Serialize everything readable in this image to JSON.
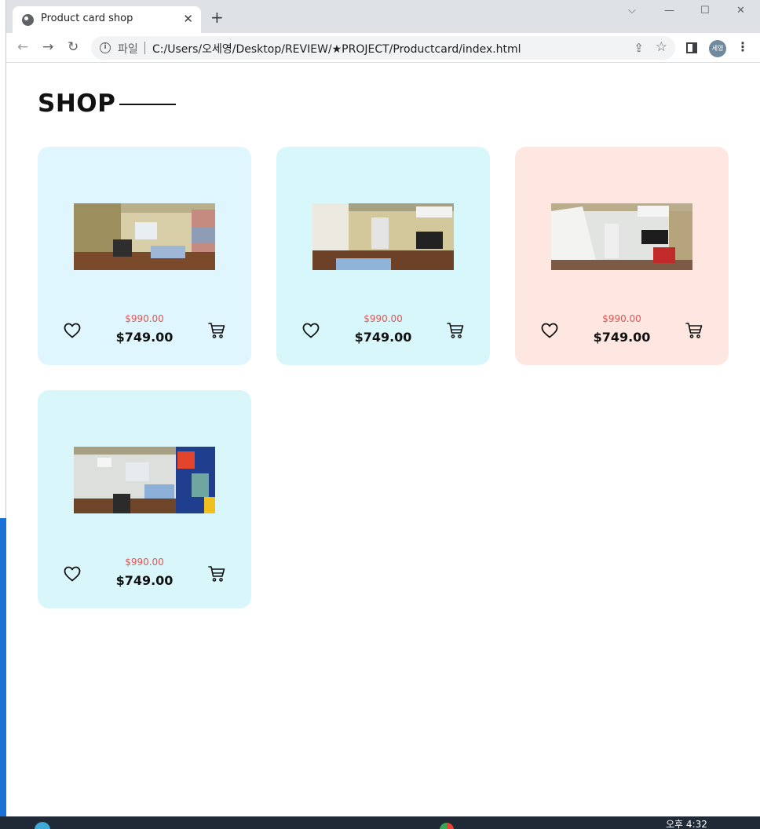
{
  "browser": {
    "tab_title": "Product card shop",
    "tab_close": "✕",
    "new_tab": "+",
    "window": {
      "dropdown": "⌵",
      "minimize": "—",
      "maximize": "☐",
      "close": "✕"
    },
    "nav": {
      "back": "←",
      "forward": "→",
      "reload": "↻"
    },
    "omnibox": {
      "info_glyph": "i",
      "scheme_label": "파일",
      "url": "C:/Users/오세영/Desktop/REVIEW/★PROJECT/Productcard/index.html"
    },
    "avatar_label": "세영",
    "menu": "⋮"
  },
  "page": {
    "title": "SHOP"
  },
  "products": [
    {
      "old_price": "$990.00",
      "price": "$749.00",
      "bg": "#e0f6fe",
      "photo": "room-a"
    },
    {
      "old_price": "$990.00",
      "price": "$749.00",
      "bg": "#d8f7fa",
      "photo": "room-b"
    },
    {
      "old_price": "$990.00",
      "price": "$749.00",
      "bg": "#fde7e0",
      "photo": "room-c"
    },
    {
      "old_price": "$990.00",
      "price": "$749.00",
      "bg": "#d9f7fa",
      "photo": "room-d"
    }
  ],
  "icons": {
    "favorite": "heart-icon",
    "cart": "cart-icon"
  },
  "taskbar": {
    "clock": "오후 4:32"
  },
  "colors": {
    "old_price": "#e05555",
    "text": "#111111"
  }
}
